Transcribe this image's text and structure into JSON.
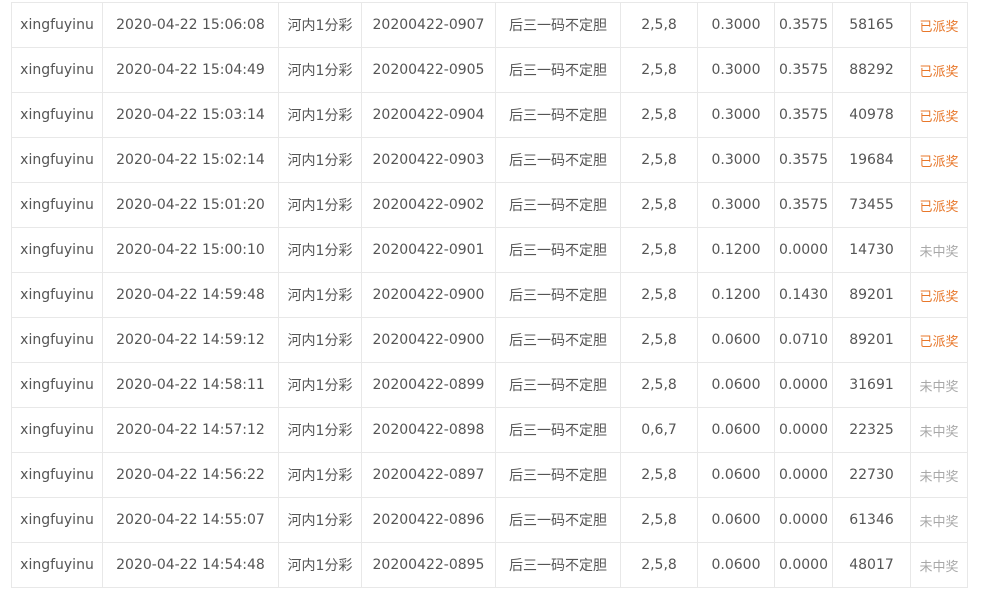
{
  "colors": {
    "paid": "#e8772a",
    "not_won": "#a8a8a8",
    "text": "#555555",
    "border": "#e8e8e8"
  },
  "rows": [
    {
      "user": "xingfuyinu",
      "time": "2020-04-22 15:06:08",
      "lottery": "河内1分彩",
      "issue": "20200422-0907",
      "play": "后三一码不定胆",
      "numbers": "2,5,8",
      "amount": "0.3000",
      "prize": "0.3575",
      "order": "58165",
      "status": "已派奖",
      "status_type": "paid"
    },
    {
      "user": "xingfuyinu",
      "time": "2020-04-22 15:04:49",
      "lottery": "河内1分彩",
      "issue": "20200422-0905",
      "play": "后三一码不定胆",
      "numbers": "2,5,8",
      "amount": "0.3000",
      "prize": "0.3575",
      "order": "88292",
      "status": "已派奖",
      "status_type": "paid"
    },
    {
      "user": "xingfuyinu",
      "time": "2020-04-22 15:03:14",
      "lottery": "河内1分彩",
      "issue": "20200422-0904",
      "play": "后三一码不定胆",
      "numbers": "2,5,8",
      "amount": "0.3000",
      "prize": "0.3575",
      "order": "40978",
      "status": "已派奖",
      "status_type": "paid"
    },
    {
      "user": "xingfuyinu",
      "time": "2020-04-22 15:02:14",
      "lottery": "河内1分彩",
      "issue": "20200422-0903",
      "play": "后三一码不定胆",
      "numbers": "2,5,8",
      "amount": "0.3000",
      "prize": "0.3575",
      "order": "19684",
      "status": "已派奖",
      "status_type": "paid"
    },
    {
      "user": "xingfuyinu",
      "time": "2020-04-22 15:01:20",
      "lottery": "河内1分彩",
      "issue": "20200422-0902",
      "play": "后三一码不定胆",
      "numbers": "2,5,8",
      "amount": "0.3000",
      "prize": "0.3575",
      "order": "73455",
      "status": "已派奖",
      "status_type": "paid"
    },
    {
      "user": "xingfuyinu",
      "time": "2020-04-22 15:00:10",
      "lottery": "河内1分彩",
      "issue": "20200422-0901",
      "play": "后三一码不定胆",
      "numbers": "2,5,8",
      "amount": "0.1200",
      "prize": "0.0000",
      "order": "14730",
      "status": "未中奖",
      "status_type": "lost"
    },
    {
      "user": "xingfuyinu",
      "time": "2020-04-22 14:59:48",
      "lottery": "河内1分彩",
      "issue": "20200422-0900",
      "play": "后三一码不定胆",
      "numbers": "2,5,8",
      "amount": "0.1200",
      "prize": "0.1430",
      "order": "89201",
      "status": "已派奖",
      "status_type": "paid"
    },
    {
      "user": "xingfuyinu",
      "time": "2020-04-22 14:59:12",
      "lottery": "河内1分彩",
      "issue": "20200422-0900",
      "play": "后三一码不定胆",
      "numbers": "2,5,8",
      "amount": "0.0600",
      "prize": "0.0710",
      "order": "89201",
      "status": "已派奖",
      "status_type": "paid"
    },
    {
      "user": "xingfuyinu",
      "time": "2020-04-22 14:58:11",
      "lottery": "河内1分彩",
      "issue": "20200422-0899",
      "play": "后三一码不定胆",
      "numbers": "2,5,8",
      "amount": "0.0600",
      "prize": "0.0000",
      "order": "31691",
      "status": "未中奖",
      "status_type": "lost"
    },
    {
      "user": "xingfuyinu",
      "time": "2020-04-22 14:57:12",
      "lottery": "河内1分彩",
      "issue": "20200422-0898",
      "play": "后三一码不定胆",
      "numbers": "0,6,7",
      "amount": "0.0600",
      "prize": "0.0000",
      "order": "22325",
      "status": "未中奖",
      "status_type": "lost"
    },
    {
      "user": "xingfuyinu",
      "time": "2020-04-22 14:56:22",
      "lottery": "河内1分彩",
      "issue": "20200422-0897",
      "play": "后三一码不定胆",
      "numbers": "2,5,8",
      "amount": "0.0600",
      "prize": "0.0000",
      "order": "22730",
      "status": "未中奖",
      "status_type": "lost"
    },
    {
      "user": "xingfuyinu",
      "time": "2020-04-22 14:55:07",
      "lottery": "河内1分彩",
      "issue": "20200422-0896",
      "play": "后三一码不定胆",
      "numbers": "2,5,8",
      "amount": "0.0600",
      "prize": "0.0000",
      "order": "61346",
      "status": "未中奖",
      "status_type": "lost"
    },
    {
      "user": "xingfuyinu",
      "time": "2020-04-22 14:54:48",
      "lottery": "河内1分彩",
      "issue": "20200422-0895",
      "play": "后三一码不定胆",
      "numbers": "2,5,8",
      "amount": "0.0600",
      "prize": "0.0000",
      "order": "48017",
      "status": "未中奖",
      "status_type": "lost"
    }
  ]
}
